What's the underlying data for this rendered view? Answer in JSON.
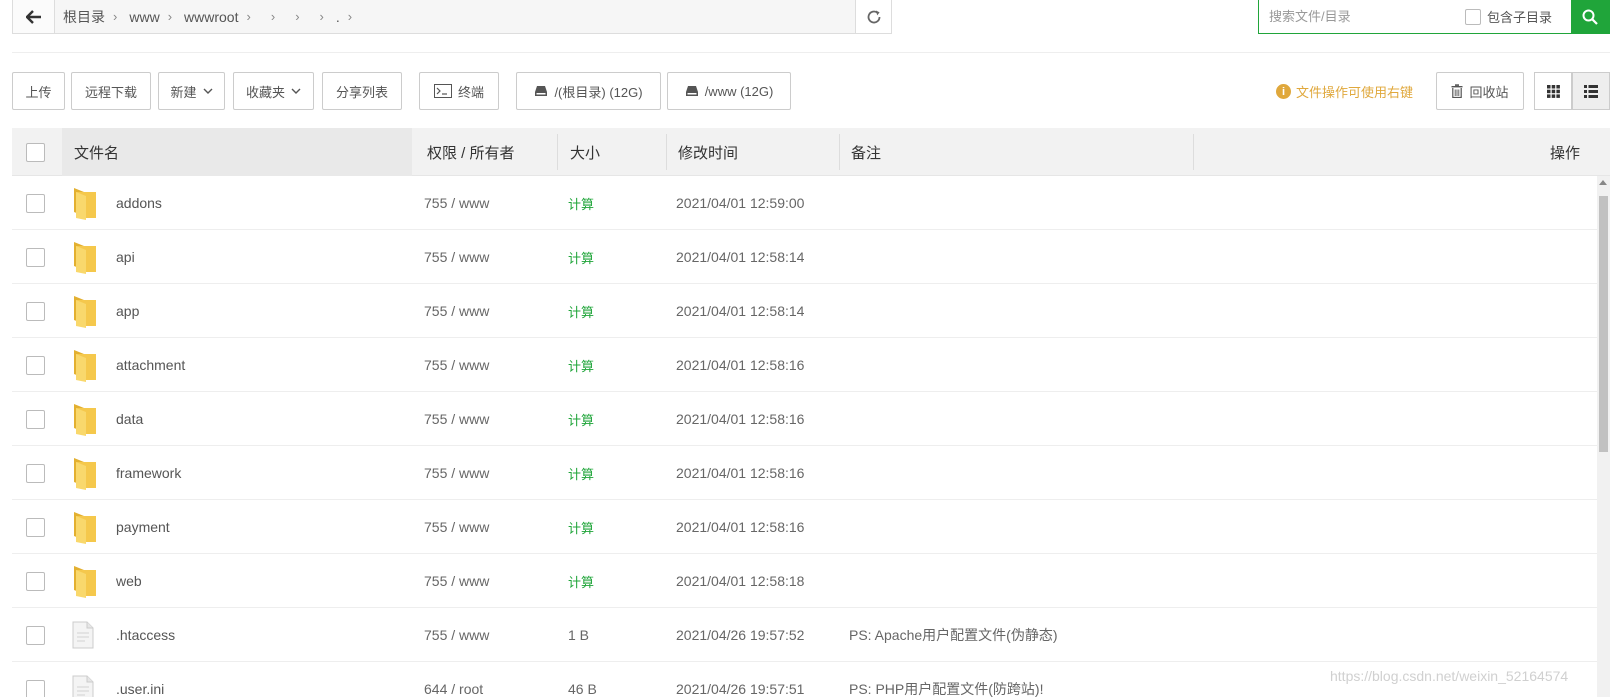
{
  "breadcrumb": {
    "items": [
      "根目录",
      "www",
      "wwwroot",
      "",
      "",
      "",
      "."
    ]
  },
  "search": {
    "placeholder": "搜索文件/目录",
    "include_sub_label": "包含子目录"
  },
  "toolbar": {
    "upload": "上传",
    "remote_download": "远程下载",
    "new": "新建",
    "favorites": "收藏夹",
    "share_list": "分享列表",
    "terminal": "终端",
    "disk_root": "/(根目录) (12G)",
    "disk_www": "/www (12G)",
    "hint": "文件操作可使用右键",
    "recycle_bin": "回收站"
  },
  "table": {
    "headers": {
      "name": "文件名",
      "perm": "权限 / 所有者",
      "size": "大小",
      "mtime": "修改时间",
      "note": "备注",
      "ops": "操作"
    },
    "rows": [
      {
        "type": "folder",
        "name": "addons",
        "perm": "755 / www",
        "size": "计算",
        "mtime": "2021/04/01 12:59:00",
        "note": ""
      },
      {
        "type": "folder",
        "name": "api",
        "perm": "755 / www",
        "size": "计算",
        "mtime": "2021/04/01 12:58:14",
        "note": ""
      },
      {
        "type": "folder",
        "name": "app",
        "perm": "755 / www",
        "size": "计算",
        "mtime": "2021/04/01 12:58:14",
        "note": ""
      },
      {
        "type": "folder",
        "name": "attachment",
        "perm": "755 / www",
        "size": "计算",
        "mtime": "2021/04/01 12:58:16",
        "note": ""
      },
      {
        "type": "folder",
        "name": "data",
        "perm": "755 / www",
        "size": "计算",
        "mtime": "2021/04/01 12:58:16",
        "note": ""
      },
      {
        "type": "folder",
        "name": "framework",
        "perm": "755 / www",
        "size": "计算",
        "mtime": "2021/04/01 12:58:16",
        "note": ""
      },
      {
        "type": "folder",
        "name": "payment",
        "perm": "755 / www",
        "size": "计算",
        "mtime": "2021/04/01 12:58:16",
        "note": ""
      },
      {
        "type": "folder",
        "name": "web",
        "perm": "755 / www",
        "size": "计算",
        "mtime": "2021/04/01 12:58:18",
        "note": ""
      },
      {
        "type": "file",
        "name": ".htaccess",
        "perm": "755 / www",
        "size": "1 B",
        "mtime": "2021/04/26 19:57:52",
        "note": "PS: Apache用户配置文件(伪静态)"
      },
      {
        "type": "file",
        "name": ".user.ini",
        "perm": "644 / root",
        "size": "46 B",
        "mtime": "2021/04/26 19:57:51",
        "note": "PS: PHP用户配置文件(防跨站)!"
      }
    ]
  },
  "watermark": "https://blog.csdn.net/weixin_52164574",
  "colors": {
    "accent": "#20a53a",
    "hint": "#e0a83c",
    "folder": "#f5c84c"
  }
}
